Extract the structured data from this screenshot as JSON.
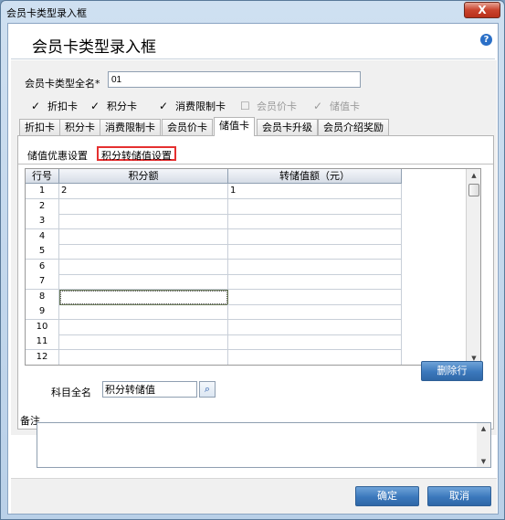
{
  "window": {
    "title": "会员卡类型录入框",
    "close_symbol": "X"
  },
  "header": {
    "title": "会员卡类型录入框",
    "help_symbol": "?"
  },
  "form": {
    "name_label": "会员卡类型全名*",
    "name_value": "01"
  },
  "options": [
    {
      "label": "折扣卡",
      "checked": true,
      "enabled": true
    },
    {
      "label": "积分卡",
      "checked": true,
      "enabled": true
    },
    {
      "label": "消费限制卡",
      "checked": true,
      "enabled": true
    },
    {
      "label": "会员价卡",
      "checked": false,
      "enabled": false
    },
    {
      "label": "储值卡",
      "checked": true,
      "enabled": false
    }
  ],
  "tabs": [
    {
      "label": "折扣卡",
      "active": false
    },
    {
      "label": "积分卡",
      "active": false
    },
    {
      "label": "消费限制卡",
      "active": false
    },
    {
      "label": "会员价卡",
      "active": false
    },
    {
      "label": "储值卡",
      "active": true
    },
    {
      "label": "会员卡升级",
      "active": false
    },
    {
      "label": "会员介绍奖励",
      "active": false
    }
  ],
  "subtabs": [
    {
      "label": "储值优惠设置",
      "active": false
    },
    {
      "label": "积分转储值设置",
      "active": true
    }
  ],
  "grid": {
    "columns": [
      "行号",
      "积分额",
      "转储值额（元）"
    ],
    "rows": [
      {
        "num": "1",
        "points": "2",
        "value": "1"
      },
      {
        "num": "2",
        "points": "",
        "value": ""
      },
      {
        "num": "3",
        "points": "",
        "value": ""
      },
      {
        "num": "4",
        "points": "",
        "value": ""
      },
      {
        "num": "5",
        "points": "",
        "value": ""
      },
      {
        "num": "6",
        "points": "",
        "value": ""
      },
      {
        "num": "7",
        "points": "",
        "value": ""
      },
      {
        "num": "8",
        "points": "",
        "value": ""
      },
      {
        "num": "9",
        "points": "",
        "value": ""
      },
      {
        "num": "10",
        "points": "",
        "value": ""
      },
      {
        "num": "11",
        "points": "",
        "value": ""
      },
      {
        "num": "12",
        "points": "",
        "value": ""
      }
    ],
    "scroll_up": "▲",
    "scroll_down": "▼"
  },
  "account": {
    "label": "科目全名",
    "value": "积分转储值",
    "search_icon": "search-icon"
  },
  "buttons": {
    "delete_row": "删除行",
    "ok": "确定",
    "cancel": "取消"
  },
  "notes": {
    "label": "备注",
    "value": ""
  },
  "colors": {
    "accent": "#3b78bc",
    "highlight_border": "#e53030",
    "close": "#c9432d"
  }
}
